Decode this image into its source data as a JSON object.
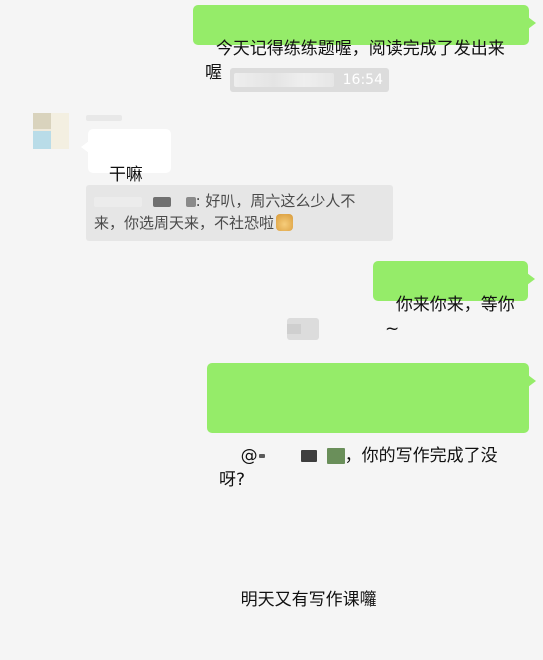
{
  "messages": {
    "m1_text": "今天记得练练题喔，阅读完成了发出来喔",
    "time": "16:54",
    "m2_text": "干嘛",
    "m2_emoji": "sleepy-emoji",
    "quote_prefix": ": 好叭，周六这么少人不",
    "quote_line2": "来，你选周天来，不社恐啦",
    "quote_emoji": "doge-emoji",
    "m3_text": "你来你来，等你~",
    "m4_mention": "@",
    "m4_line1_rest": "，你的写作完成了没呀?",
    "m4_line2": "明天又有写作课囖"
  },
  "colors": {
    "self_bubble": "#95ec69",
    "other_bubble": "#ffffff",
    "background": "#f5f5f5",
    "quote_bg": "#e6e6e6"
  }
}
